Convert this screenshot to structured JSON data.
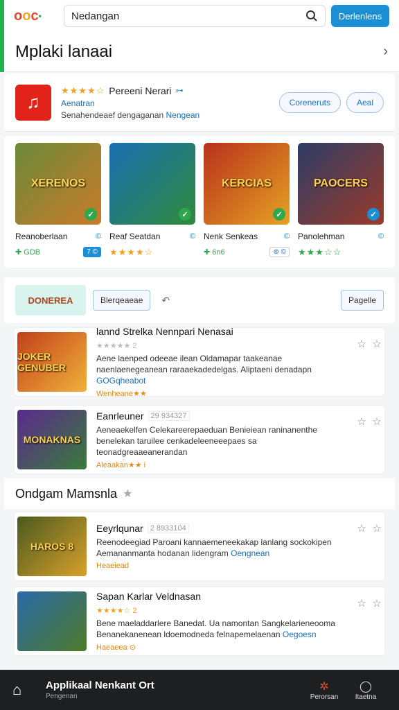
{
  "topbar": {
    "search_value": "Nedangan",
    "search_button": "Derlenlens"
  },
  "header": {
    "title": "Mplaki lanaai"
  },
  "featured": {
    "name": "Pereeni Nerari",
    "stars": "★★★★☆",
    "verified": "⊶",
    "developer": "Aenatran",
    "desc_prefix": "Senahendeaef dengaganan",
    "desc_link": "Nengean",
    "btn1": "Coreneruts",
    "btn2": "Aeal"
  },
  "tiles": [
    {
      "art": "XERENOS",
      "name": "Reanoberlaan",
      "info": "©",
      "meta": "✚ GDB",
      "box": "7 ©",
      "box_style": "blue",
      "color1": "#6b8a3a",
      "color2": "#c97b2a"
    },
    {
      "art": "",
      "name": "Reaf Seatdan",
      "info": "©",
      "meta": "★★★★☆",
      "box": "",
      "box_style": "",
      "color1": "#1b6fb3",
      "color2": "#2f8a3c"
    },
    {
      "art": "KERCIAS",
      "name": "Nenk Senkeas",
      "info": "©",
      "meta": "✚ 6n6",
      "box": "⊚ ©",
      "box_style": "",
      "color1": "#b8311c",
      "color2": "#e5a223"
    },
    {
      "art": "PAOCERS",
      "name": "Panolehman",
      "info": "©",
      "meta": "★★★☆☆",
      "box": "",
      "box_style": "",
      "color1": "#2c3c66",
      "color2": "#9a3b2a"
    }
  ],
  "filter": {
    "banner": "DONEREA",
    "btn1": "Blerqeaeae",
    "arrow": "↶",
    "btn2": "Pagelle"
  },
  "list1": [
    {
      "art": "JOKER GENUBER",
      "title": "lannd Strelka Nennpari Nenasai",
      "tag": "",
      "stars": "★★★★★ 2",
      "desc": "Aene laenped odeeae ilean Oldamapar taakeanae naenlaenegeanean raraaekadedelgas. Aliptaeni denadapn",
      "desc_link": "GOGqheabot",
      "sub": "Wenheane★★",
      "color1": "#c2401a",
      "color2": "#f0b23b"
    },
    {
      "art": "MONAKNAS",
      "title": "Eanrleuner",
      "tag": "29 934327",
      "stars": "",
      "desc": "Aeneaekelfen Celekareerepaeduan Benieiean raninanenthe benelekan taruilee cenkadeleeneeepaes sa teonadgreaaeanerandan",
      "desc_link": "",
      "sub": "Aleaakan★★ i",
      "color1": "#5a2a8e",
      "color2": "#3a7a3a"
    }
  ],
  "section": {
    "title": "Ondgam Mamsnla",
    "star": "★"
  },
  "list2": [
    {
      "art": "HAROS 8",
      "title": "Eeyrlqunar",
      "tag": "2 8933104",
      "stars": "",
      "desc": "Reenodeegiad Paroani kannaemeneekakap lanlang sockokipen Aemananmanta hodanan lidengram",
      "desc_link": "Oengnean",
      "sub": "Heaeiead",
      "color1": "#4a5a1e",
      "color2": "#d9a02c"
    },
    {
      "art": "",
      "title": "Sapan Karlar Veldnasan",
      "tag": "",
      "stars": "★★★★☆ 2",
      "desc": "Bene maeladdarlere Banedat. Ua namontan Sangkelarieneooma Benanekanenean ldoemodneda felnapemelaenan",
      "desc_link": "Oegoesn",
      "sub": "Haeaeea ⊙",
      "color1": "#2a6aa8",
      "color2": "#4f7a2a"
    }
  ],
  "bottom": {
    "title": "Applikaal Nenkant Ort",
    "subtitle": "Pengenan",
    "tab1": "Perorsan",
    "tab2": "Itaetna"
  }
}
